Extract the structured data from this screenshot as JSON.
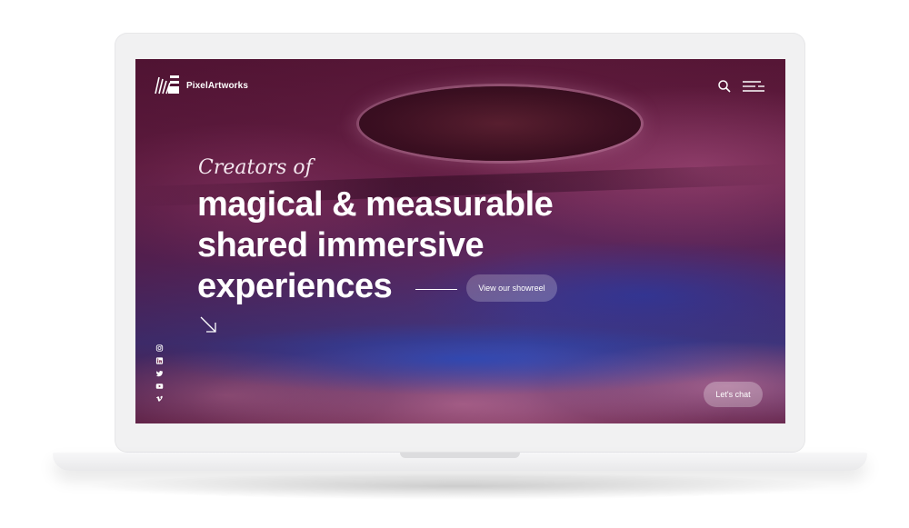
{
  "brand": {
    "name": "PixelArtworks",
    "logo_icon": "pixelartworks-logo-mark"
  },
  "header": {
    "search_icon": "search-icon",
    "menu_icon": "menu-icon"
  },
  "hero": {
    "eyebrow": "Creators of",
    "headline_lines": [
      "magical & measurable",
      "shared immersive",
      "experiences"
    ],
    "cta_label": "View our showreel",
    "scroll_icon": "arrow-down-right-icon"
  },
  "social": {
    "items": [
      {
        "icon": "instagram-icon"
      },
      {
        "icon": "linkedin-icon"
      },
      {
        "icon": "twitter-icon"
      },
      {
        "icon": "youtube-icon"
      },
      {
        "icon": "vimeo-icon"
      }
    ]
  },
  "chat": {
    "label": "Let's chat"
  },
  "colors": {
    "text": "#ffffff",
    "bezel": "#f1f1f2",
    "background_tint": "#5a1838"
  }
}
